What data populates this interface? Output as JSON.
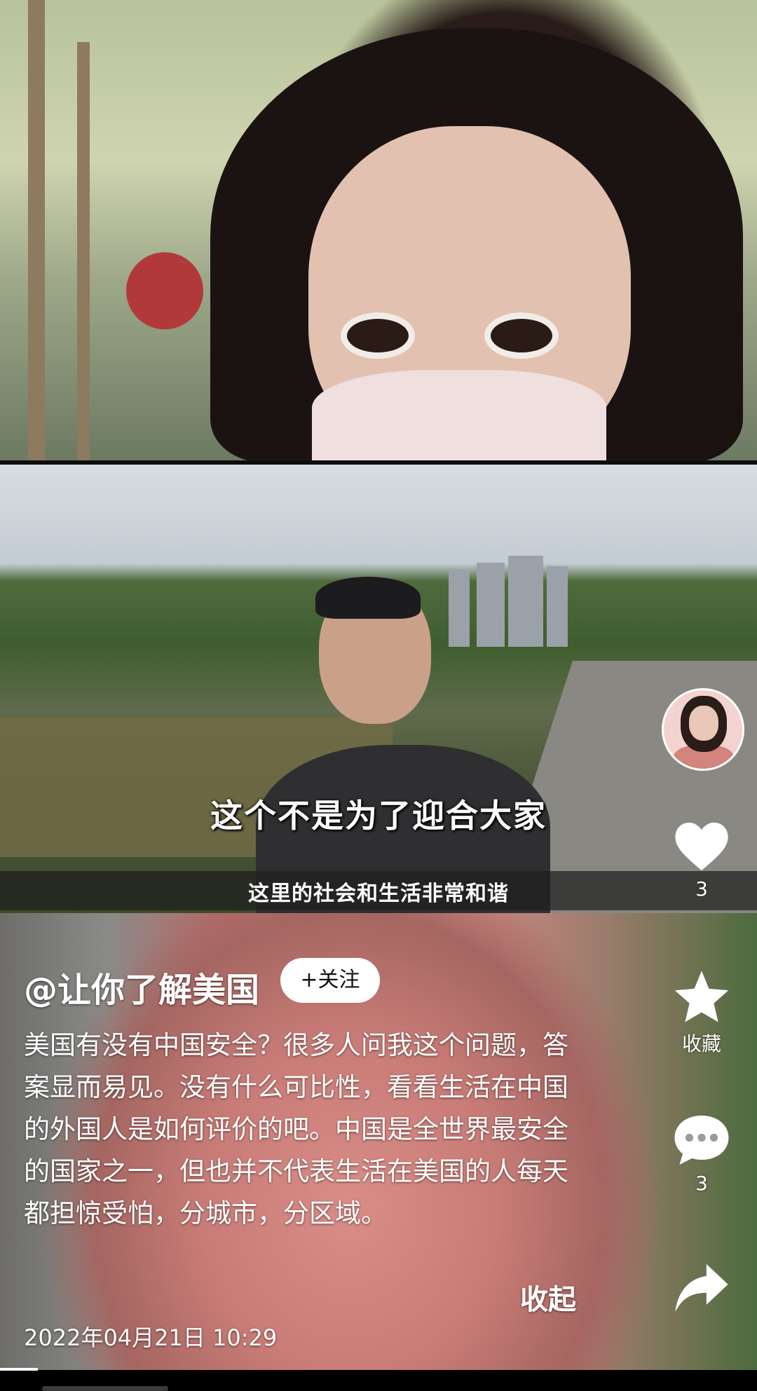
{
  "video": {
    "subtitle_main": "这个不是为了迎合大家",
    "subtitle_translation": "这里的社会和生活非常和谐",
    "progress": 0.05
  },
  "author": {
    "handle": "@让你了解美国",
    "follow_label": "+关注"
  },
  "actions": {
    "like": {
      "icon": "heart-icon",
      "count": "3"
    },
    "favorite": {
      "icon": "star-icon",
      "label": "收藏"
    },
    "comment": {
      "icon": "comment-bubble-icon",
      "count": "3"
    },
    "share": {
      "icon": "share-arrow-icon"
    }
  },
  "caption": {
    "text": "美国有没有中国安全？很多人问我这个问题，答案显而易见。没有什么可比性，看看生活在中国的外国人是如何评价的吧。中国是全世界最安全的国家之一，但也并不代表生活在美国的人每天都担惊受怕，分城市，分区域。",
    "collapse_label": "收起",
    "timestamp": "2022年04月21日 10:29"
  },
  "colors": {
    "text": "#ffffff",
    "follow_bg": "#ffffff",
    "follow_text": "#111111"
  }
}
